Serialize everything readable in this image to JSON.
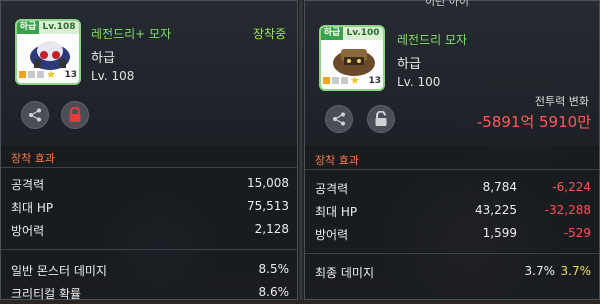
{
  "left": {
    "grade_tag": "하급",
    "level_tag": "Lv.108",
    "name": "레전드리+ 모자",
    "subtitle": "하급",
    "level": "Lv. 108",
    "equipped_label": "장착중",
    "star_count": "13",
    "section_title": "장착 효과",
    "stats": [
      {
        "label": "공격력",
        "value": "15,008"
      },
      {
        "label": "최대 HP",
        "value": "75,513"
      },
      {
        "label": "방어력",
        "value": "2,128"
      },
      {
        "label": "일반 몬스터 데미지",
        "value": "8.5%"
      },
      {
        "label": "크리티컬 확률",
        "value": "8.6%"
      }
    ]
  },
  "right": {
    "header_fragment": "이런 아이",
    "grade_tag": "하급",
    "level_tag": "Lv.100",
    "name": "레전드리 모자",
    "subtitle": "하급",
    "level": "Lv. 100",
    "star_count": "13",
    "power_change_label": "전투력 변화",
    "power_change_value": "-5891억 5910만",
    "section_title": "장착 효과",
    "stats": [
      {
        "label": "공격력",
        "value": "8,784",
        "diff": "-6,224",
        "diff_type": "neg"
      },
      {
        "label": "최대 HP",
        "value": "43,225",
        "diff": "-32,288",
        "diff_type": "neg"
      },
      {
        "label": "방어력",
        "value": "1,599",
        "diff": "-529",
        "diff_type": "neg"
      },
      {
        "label": "최종 데미지",
        "value": "3.7%",
        "diff": "3.7%",
        "diff_type": "pos"
      }
    ]
  },
  "colors": {
    "grade_green": "#3aa24a",
    "name_green": "#7fe06a",
    "equipped_green": "#9be55b",
    "negative_red": "#ff5252",
    "positive_yellow": "#e9e04a",
    "section_orange": "#ff7a40"
  },
  "icons": [
    "share-icon",
    "lock-icon",
    "unlock-icon",
    "star-icon"
  ]
}
